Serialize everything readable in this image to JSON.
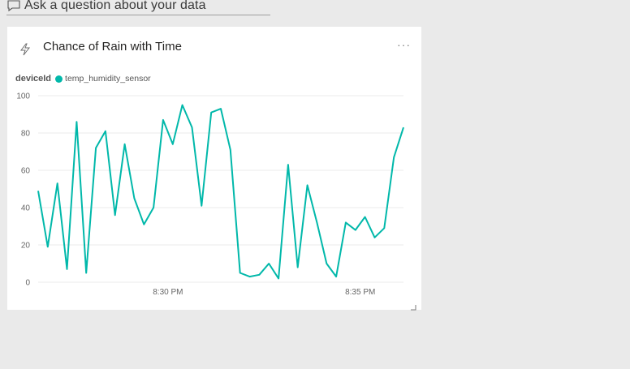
{
  "qa": {
    "placeholder": "Ask a question about your data"
  },
  "tile": {
    "title": "Chance of Rain with Time",
    "more": "···"
  },
  "legend": {
    "title": "deviceId",
    "series_label": "temp_humidity_sensor",
    "color": "#01b8aa"
  },
  "chart_data": {
    "type": "line",
    "title": "Chance of Rain with Time",
    "legend_title": "deviceId",
    "xlabel": "",
    "ylabel": "",
    "ylim": [
      0,
      100
    ],
    "yticks": [
      0,
      20,
      40,
      60,
      80,
      100
    ],
    "xticks": [
      {
        "label": "8:30 PM",
        "index": 13.5
      },
      {
        "label": "8:35 PM",
        "index": 33.5
      }
    ],
    "grid": true,
    "legend_position": "top-left",
    "series": [
      {
        "name": "temp_humidity_sensor",
        "color": "#01b8aa",
        "values": [
          49,
          19,
          53,
          7,
          86,
          5,
          72,
          81,
          36,
          74,
          45,
          31,
          40,
          87,
          74,
          95,
          83,
          41,
          91,
          93,
          71,
          5,
          3,
          4,
          10,
          2,
          63,
          8,
          52,
          32,
          10,
          3,
          32,
          28,
          35,
          24,
          29,
          67,
          83
        ]
      }
    ]
  }
}
